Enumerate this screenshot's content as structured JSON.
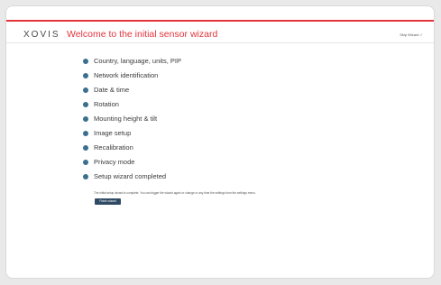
{
  "header": {
    "logo": "XOVIS",
    "title": "Welcome to the initial sensor wizard",
    "skip_label": "Skip Wizard ✓"
  },
  "steps": [
    {
      "label": "Country, language, units, PIP",
      "status": "done"
    },
    {
      "label": "Network identification",
      "status": "done"
    },
    {
      "label": "Date & time",
      "status": "done"
    },
    {
      "label": "Rotation",
      "status": "done"
    },
    {
      "label": "Mounting height & tilt",
      "status": "done"
    },
    {
      "label": "Image setup",
      "status": "done"
    },
    {
      "label": "Recalibration",
      "status": "done"
    },
    {
      "label": "Privacy mode",
      "status": "done"
    },
    {
      "label": "Setup wizard completed",
      "status": "current"
    }
  ],
  "completion": {
    "description": "The initial setup wizard is complete. You can trigger the wizard again or change or any time the settings from the settings menu.",
    "finish_label": "Finish wizard"
  },
  "colors": {
    "accent": "#e3343c",
    "step_done": "#3b6f8f",
    "button": "#2f4a64"
  }
}
